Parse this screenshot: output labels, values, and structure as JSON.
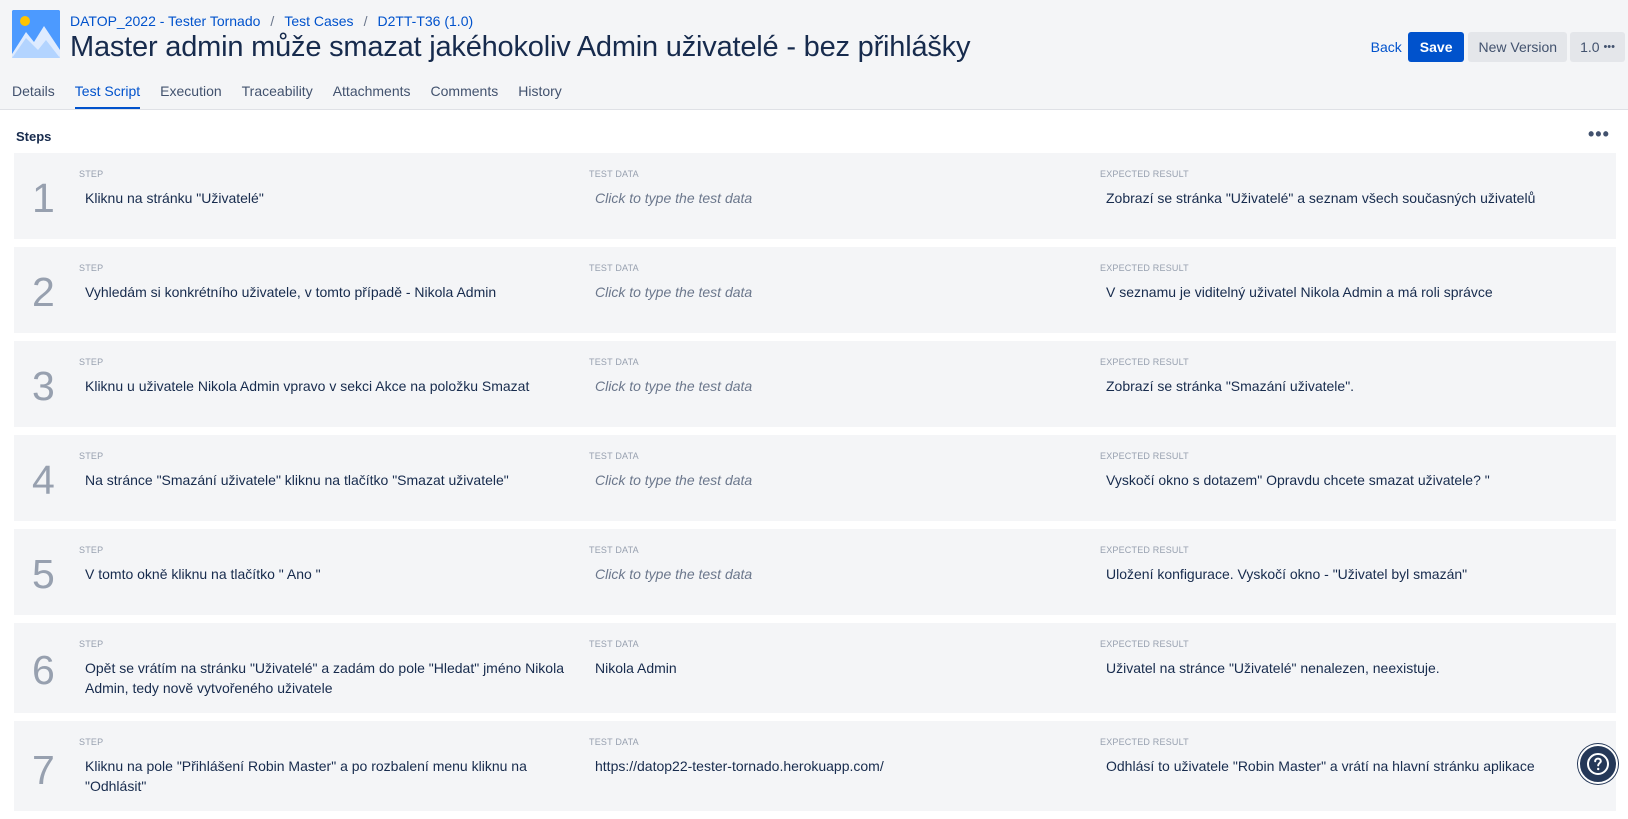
{
  "breadcrumb": {
    "project": "DATOP_2022 - Tester Tornado",
    "section": "Test Cases",
    "key": "D2TT-T36 (1.0)"
  },
  "page_title": "Master admin může smazat jakéhokoliv Admin uživatelé - bez přihlášky",
  "actions": {
    "back": "Back",
    "save": "Save",
    "new_version": "New Version",
    "version": "1.0",
    "more": "•••"
  },
  "tabs": [
    {
      "label": "Details"
    },
    {
      "label": "Test Script"
    },
    {
      "label": "Execution"
    },
    {
      "label": "Traceability"
    },
    {
      "label": "Attachments"
    },
    {
      "label": "Comments"
    },
    {
      "label": "History"
    }
  ],
  "active_tab": "Test Script",
  "steps_title": "Steps",
  "steps_more": "•••",
  "column_labels": {
    "step": "STEP",
    "test_data": "TEST DATA",
    "expected_result": "EXPECTED RESULT"
  },
  "steps": [
    {
      "number": "1",
      "step": "Kliknu na stránku \"Uživatelé\"",
      "test_data": "Click to type the test data",
      "test_data_empty": true,
      "expected": "Zobrazí se stránka \"Uživatelé\" a seznam všech současných uživatelů"
    },
    {
      "number": "2",
      "step": "Vyhledám si konkrétního uživatele, v tomto případě - Nikola Admin",
      "test_data": "Click to type the test data",
      "test_data_empty": true,
      "expected": "V seznamu je viditelný uživatel Nikola Admin a má roli správce"
    },
    {
      "number": "3",
      "step": "Kliknu u uživatele Nikola Admin vpravo v sekci Akce na položku Smazat",
      "test_data": "Click to type the test data",
      "test_data_empty": true,
      "expected": "Zobrazí se stránka \"Smazání uživatele\"."
    },
    {
      "number": "4",
      "step": "Na stránce \"Smazání uživatele\" kliknu na tlačítko \"Smazat uživatele\"",
      "test_data": "Click to type the test data",
      "test_data_empty": true,
      "expected": "Vyskočí okno s dotazem\" Opravdu chcete smazat uživatele? \""
    },
    {
      "number": "5",
      "step": "V tomto okně kliknu na tlačítko \" Ano \"",
      "test_data": "Click to type the test data",
      "test_data_empty": true,
      "expected": "Uložení konfigurace. Vyskočí okno  - \"Uživatel byl smazán\""
    },
    {
      "number": "6",
      "step": "Opět se vrátím na stránku \"Uživatelé\" a zadám do pole \"Hledat\" jméno Nikola Admin, tedy nově vytvořeného uživatele",
      "test_data": "Nikola Admin",
      "test_data_empty": false,
      "expected": "Uživatel na stránce \"Uživatelé\" nenalezen, neexistuje."
    },
    {
      "number": "7",
      "step": "Kliknu na pole \"Přihlášení Robin Master\" a po rozbalení menu kliknu na \"Odhlásit\"",
      "test_data": "https://datop22-tester-tornado.herokuapp.com/",
      "test_data_empty": false,
      "expected": "Odhlásí to uživatele \"Robin Master\" a vrátí na hlavní stránku aplikace"
    }
  ],
  "help_icon": "question-icon",
  "colors": {
    "accent": "#0052cc",
    "step_bg": "#f4f5f7",
    "header_bg": "#f4f5f7"
  }
}
